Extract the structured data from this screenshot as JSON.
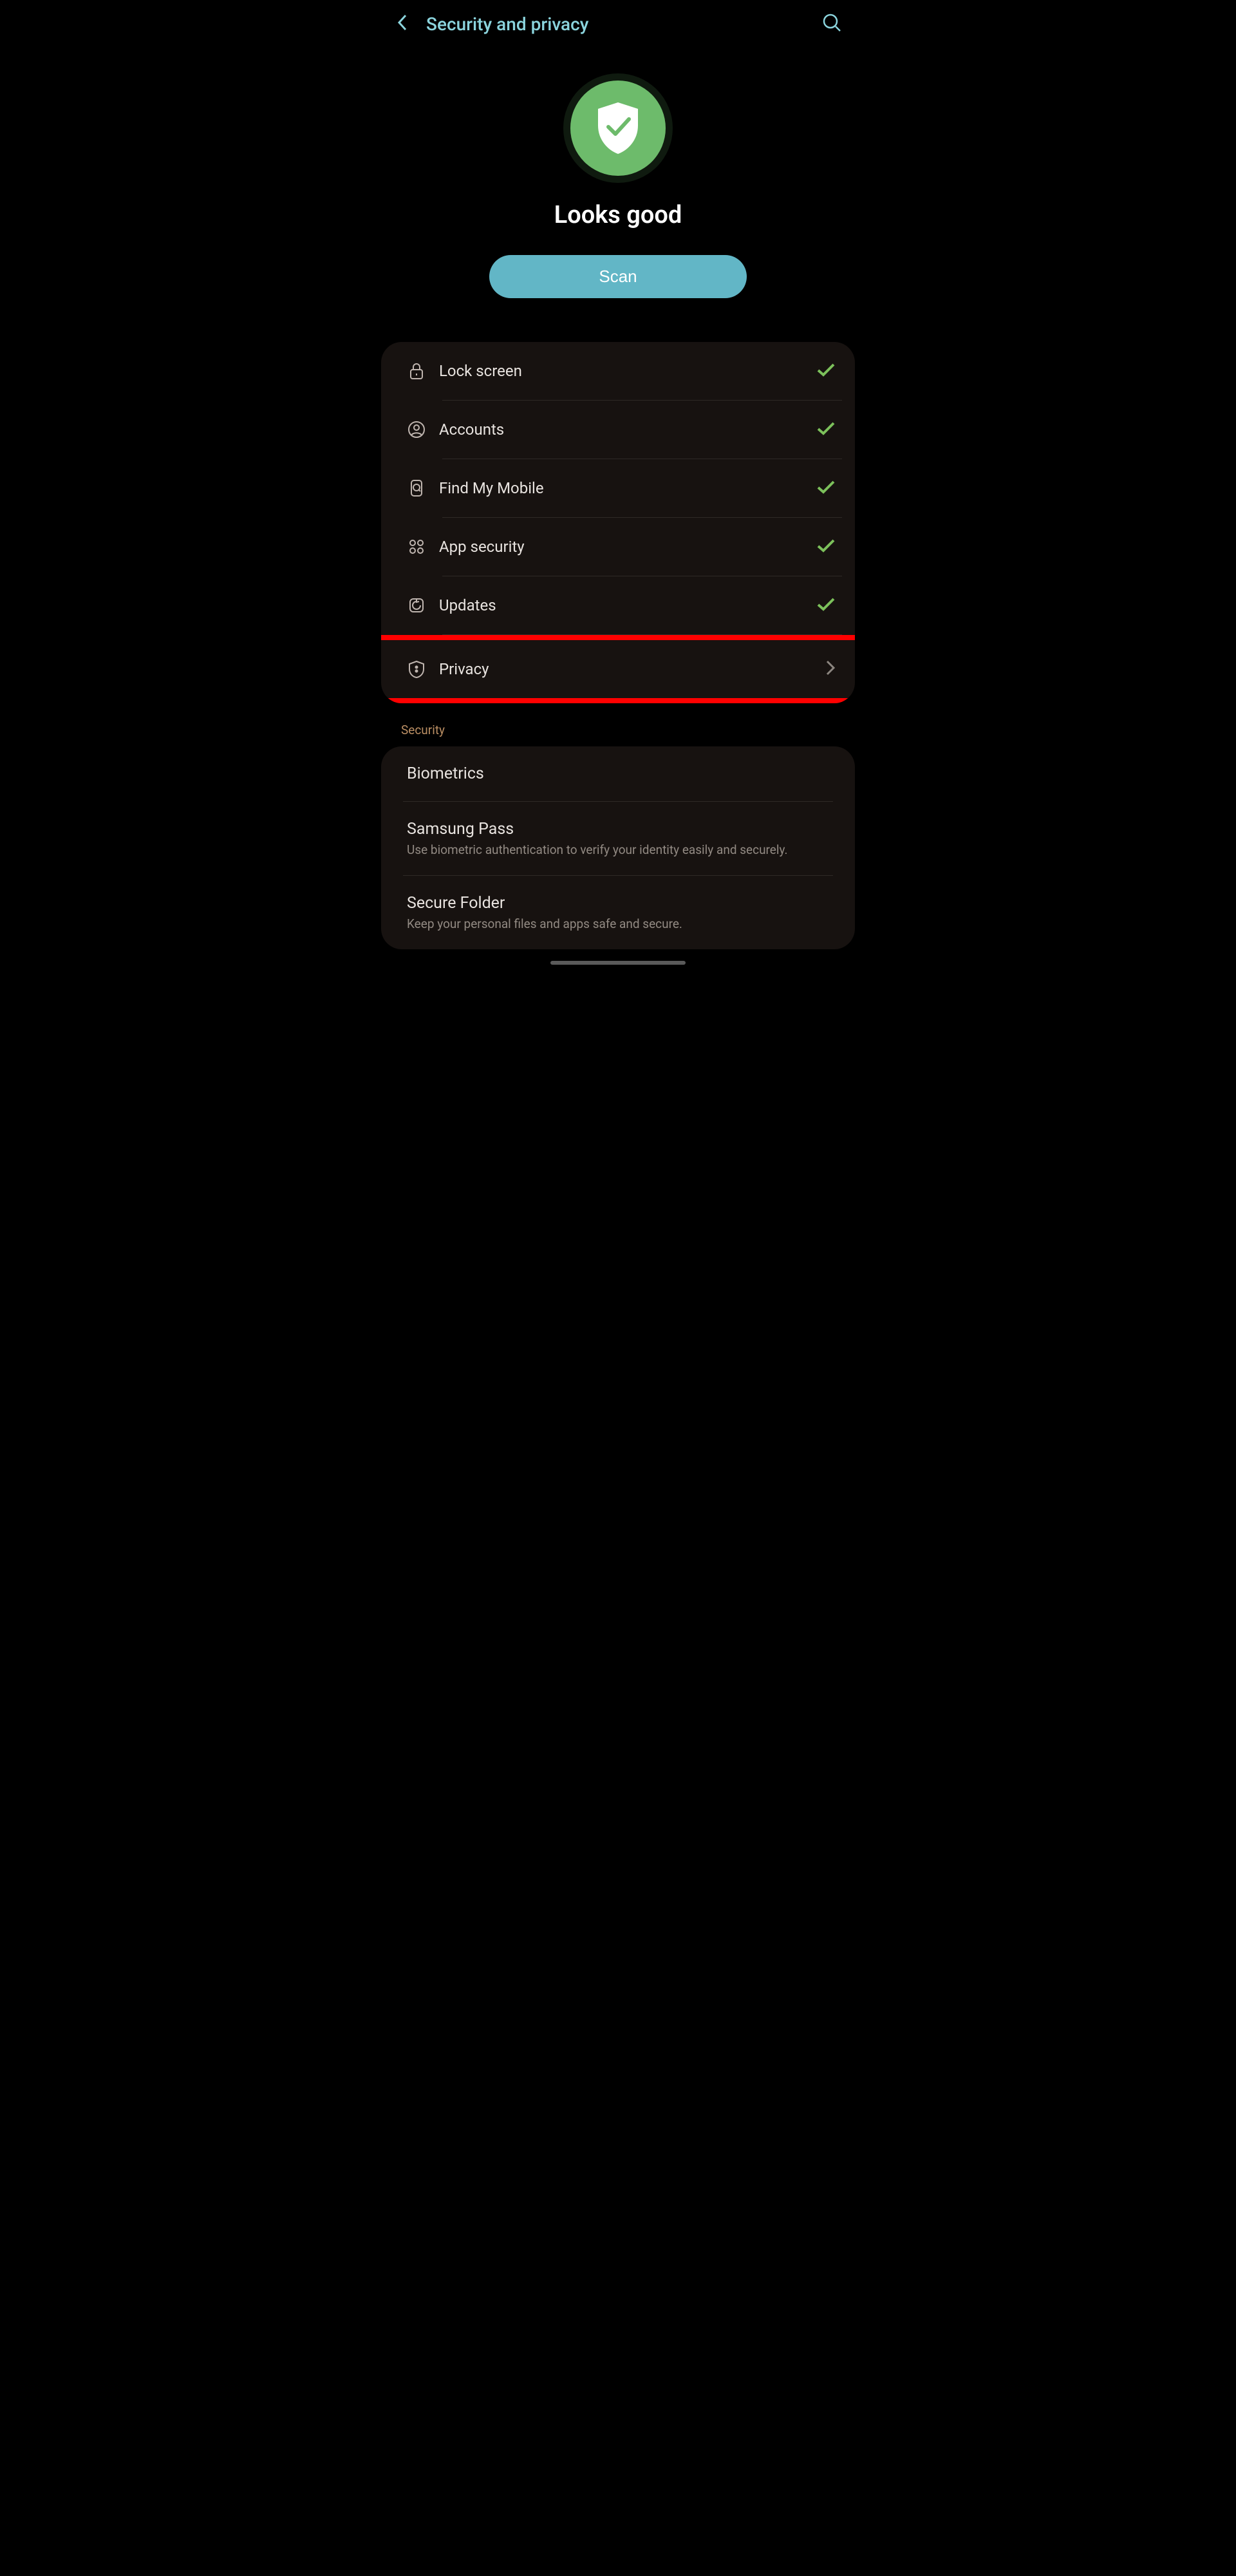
{
  "header": {
    "title": "Security and privacy"
  },
  "status": {
    "message": "Looks good",
    "button_label": "Scan"
  },
  "main_items": [
    {
      "id": "lock-screen",
      "label": "Lock screen",
      "status": "check"
    },
    {
      "id": "accounts",
      "label": "Accounts",
      "status": "check"
    },
    {
      "id": "find-my-mobile",
      "label": "Find My Mobile",
      "status": "check"
    },
    {
      "id": "app-security",
      "label": "App security",
      "status": "check"
    },
    {
      "id": "updates",
      "label": "Updates",
      "status": "check"
    },
    {
      "id": "privacy",
      "label": "Privacy",
      "status": "chevron",
      "highlighted": true
    }
  ],
  "security_section": {
    "header": "Security",
    "items": [
      {
        "title": "Biometrics",
        "subtitle": ""
      },
      {
        "title": "Samsung Pass",
        "subtitle": "Use biometric authentication to verify your identity easily and securely."
      },
      {
        "title": "Secure Folder",
        "subtitle": "Keep your personal files and apps safe and secure."
      }
    ]
  }
}
